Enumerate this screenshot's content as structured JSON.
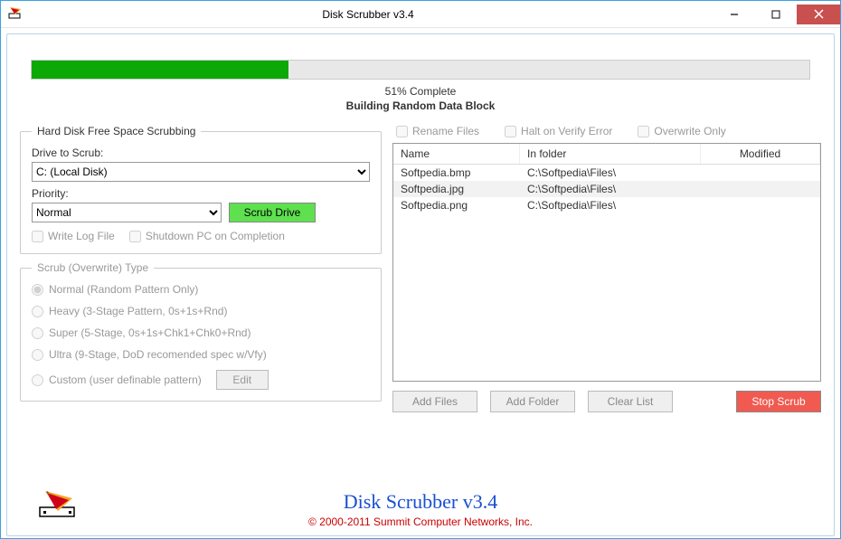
{
  "window": {
    "title": "Disk Scrubber v3.4"
  },
  "progress": {
    "percent": 51,
    "label": "51% Complete",
    "status": "Building Random Data Block"
  },
  "left": {
    "group1_title": "Hard Disk Free Space Scrubbing",
    "drive_label": "Drive to Scrub:",
    "drive_value": "C: (Local Disk)",
    "priority_label": "Priority:",
    "priority_value": "Normal",
    "scrub_drive_btn": "Scrub Drive",
    "write_log": "Write Log File",
    "shutdown": "Shutdown PC on Completion",
    "group2_title": "Scrub (Overwrite) Type",
    "radios": [
      "Normal (Random Pattern Only)",
      "Heavy (3-Stage Pattern, 0s+1s+Rnd)",
      "Super (5-Stage, 0s+1s+Chk1+Chk0+Rnd)",
      "Ultra (9-Stage, DoD recomended spec w/Vfy)",
      "Custom (user definable pattern)"
    ],
    "edit_btn": "Edit"
  },
  "right": {
    "rename": "Rename Files",
    "halt": "Halt on Verify Error",
    "overwrite": "Overwrite Only",
    "cols": {
      "name": "Name",
      "folder": "In folder",
      "mod": "Modified"
    },
    "rows": [
      {
        "name": "Softpedia.bmp",
        "folder": "C:\\Softpedia\\Files\\",
        "mod": ""
      },
      {
        "name": "Softpedia.jpg",
        "folder": "C:\\Softpedia\\Files\\",
        "mod": ""
      },
      {
        "name": "Softpedia.png",
        "folder": "C:\\Softpedia\\Files\\",
        "mod": ""
      }
    ],
    "add_files": "Add Files",
    "add_folder": "Add Folder",
    "clear_list": "Clear List",
    "stop_scrub": "Stop Scrub"
  },
  "footer": {
    "product": "Disk Scrubber v3.4",
    "copyright": "© 2000-2011 Summit Computer Networks, Inc."
  }
}
